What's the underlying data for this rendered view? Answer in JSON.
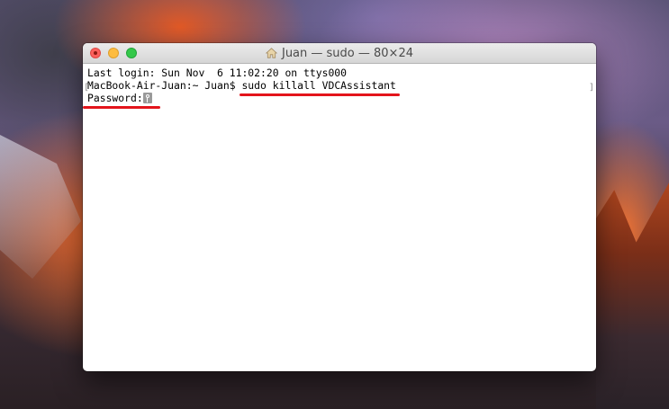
{
  "window": {
    "title": "Juan — sudo — 80×24"
  },
  "terminal": {
    "last_login": "Last login: Sun Nov  6 11:02:20 on ttys000",
    "prompt": "MacBook-Air-Juan:~ Juan$ ",
    "command": "sudo killall VDCAssistant",
    "password_prompt": "Password:"
  },
  "colors": {
    "annotation_underline": "#e3141b"
  }
}
